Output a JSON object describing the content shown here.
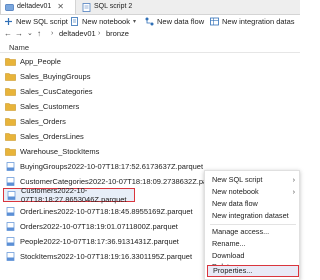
{
  "tabs": [
    {
      "label": "deltadev01",
      "active": true
    },
    {
      "label": "SQL script 2",
      "active": false
    }
  ],
  "toolbar": {
    "new_sql_script": "New SQL script",
    "new_notebook": "New notebook",
    "new_data_flow": "New data flow",
    "new_integration_dataset": "New integration datas"
  },
  "breadcrumb": [
    "deltadev01",
    "bronze"
  ],
  "list_header": "Name",
  "items": [
    {
      "name": "App_People",
      "kind": "folder"
    },
    {
      "name": "Sales_BuyingGroups",
      "kind": "folder"
    },
    {
      "name": "Sales_CusCategories",
      "kind": "folder"
    },
    {
      "name": "Sales_Customers",
      "kind": "folder"
    },
    {
      "name": "Sales_Orders",
      "kind": "folder"
    },
    {
      "name": "Sales_OrdersLines",
      "kind": "folder"
    },
    {
      "name": "Warehouse_StockItems",
      "kind": "folder"
    },
    {
      "name": "BuyingGroups2022-10-07T18:17:52.6173637Z.parquet",
      "kind": "file"
    },
    {
      "name": "CustomerCategories2022-10-07T18:18:09.2738632Z.parquet",
      "kind": "file"
    },
    {
      "name": "Customers2022-10-07T18:18:27.8653046Z.parquet",
      "kind": "file",
      "selected": true
    },
    {
      "name": "OrderLines2022-10-07T18:18:45.8955169Z.parquet",
      "kind": "file"
    },
    {
      "name": "Orders2022-10-07T18:19:01.0711800Z.parquet",
      "kind": "file"
    },
    {
      "name": "People2022-10-07T18:17:36.9131431Z.parquet",
      "kind": "file"
    },
    {
      "name": "StockItems2022-10-07T18:19:16.3301195Z.parquet",
      "kind": "file"
    }
  ],
  "context_menu": {
    "new_sql_script": "New SQL script",
    "new_notebook": "New notebook",
    "new_data_flow": "New data flow",
    "new_integration_dataset": "New integration dataset",
    "manage_access": "Manage access...",
    "rename": "Rename...",
    "download": "Download",
    "delete": "Delete",
    "properties": "Properties..."
  },
  "colors": {
    "folder": "#e8b43a",
    "file": "#5b8fd6",
    "highlight_border": "#d9353d",
    "selection_bg": "#e7eef8"
  }
}
